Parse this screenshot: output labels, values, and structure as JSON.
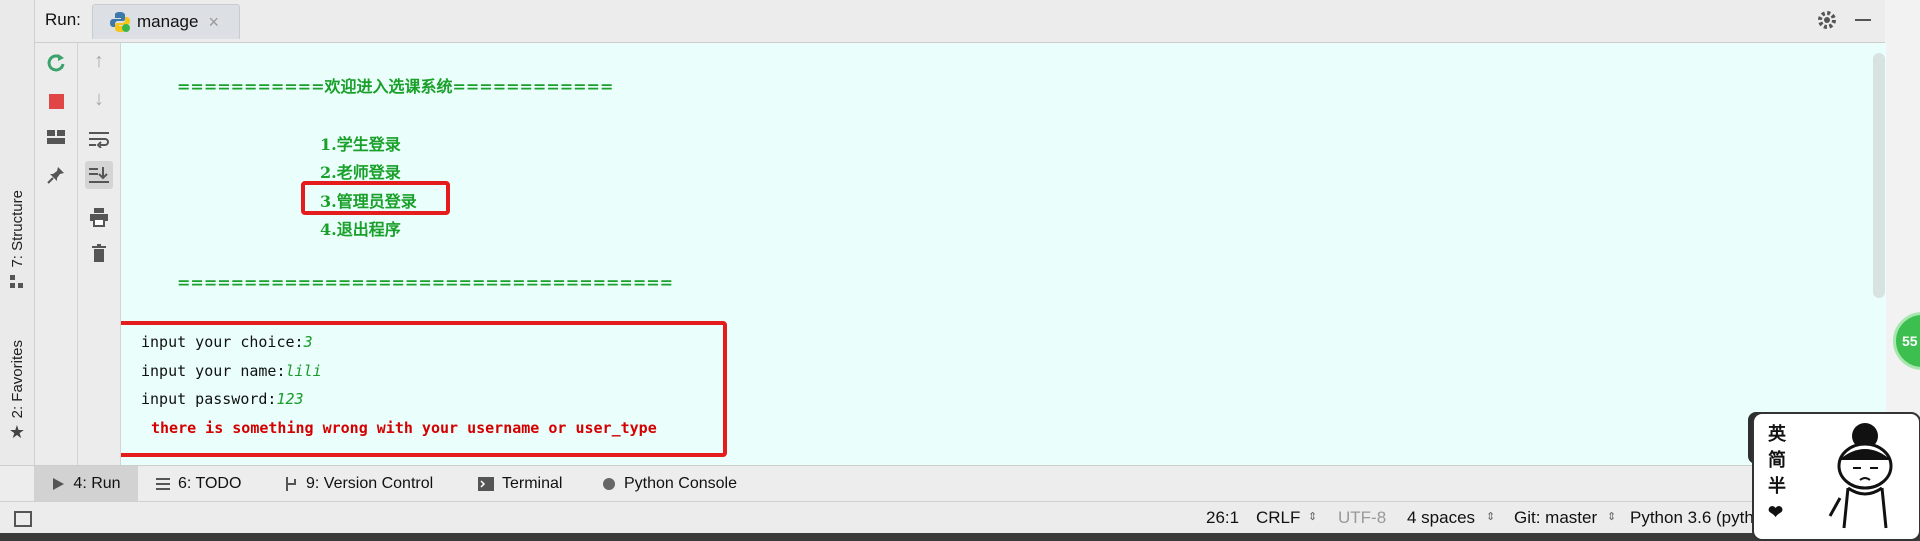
{
  "header": {
    "run_label": "Run:",
    "tab_label": "manage"
  },
  "left_strip": {
    "structure_label": "7: Structure",
    "favorites_label": "2: Favorites"
  },
  "console": {
    "banner_top": "===========欢迎进入选课系统============",
    "menu": [
      "1.学生登录",
      "2.老师登录",
      "3.管理员登录",
      "4.退出程序"
    ],
    "banner_bottom": "=====================================",
    "prompt_choice": "input your choice:",
    "input_choice": "3",
    "prompt_name": "input your name:",
    "input_name": "lili",
    "prompt_password": "input password:",
    "input_password": "123",
    "error_message": "there is something wrong with your username or user_type"
  },
  "bottom_tabs": {
    "run": "4: Run",
    "todo": "6: TODO",
    "vcs": "9: Version Control",
    "terminal": "Terminal",
    "python_console": "Python Console"
  },
  "status": {
    "position": "26:1",
    "line_sep": "CRLF",
    "encoding": "UTF-8",
    "indent": "4 spaces",
    "git": "Git: master",
    "interpreter": "Python 3.6 (pyth"
  },
  "badge": {
    "value": "55"
  },
  "sticker": {
    "chars": [
      "英",
      "简",
      "半"
    ]
  },
  "colors": {
    "console_bg": "#eafffb",
    "menu_green": "#1aa02a",
    "error_red": "#d40000",
    "highlight_red": "#e41c1c"
  }
}
